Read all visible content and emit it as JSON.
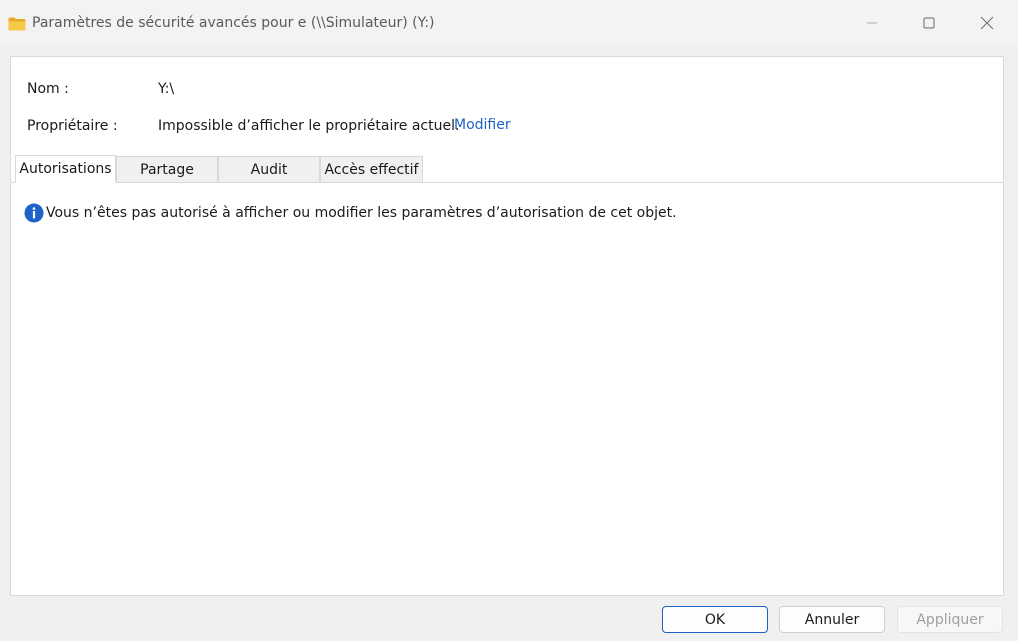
{
  "window": {
    "title": "Paramètres de sécurité avancés pour e (\\\\Simulateur) (Y:)",
    "icon": "folder-icon",
    "controls": {
      "minimize_icon": "minimize-icon",
      "maximize_icon": "maximize-icon",
      "close_icon": "close-icon"
    }
  },
  "info": {
    "name_label": "Nom :",
    "name_value": "Y:\\",
    "owner_label": "Propriétaire :",
    "owner_value": "Impossible d’afficher le propriétaire actuel.",
    "owner_link": "Modifier"
  },
  "tabs": [
    {
      "label": "Autorisations",
      "active": true
    },
    {
      "label": "Partage",
      "active": false
    },
    {
      "label": "Audit",
      "active": false
    },
    {
      "label": "Accès effectif",
      "active": false
    }
  ],
  "message": {
    "icon": "info-icon",
    "text": "Vous n’êtes pas autorisé à afficher ou modifier les paramètres d’autorisation de cet objet."
  },
  "buttons": {
    "ok": "OK",
    "cancel": "Annuler",
    "apply": "Appliquer"
  },
  "colors": {
    "accent": "#1a62c6",
    "info_icon": "#1e64c8",
    "folder": "#f4c542"
  }
}
